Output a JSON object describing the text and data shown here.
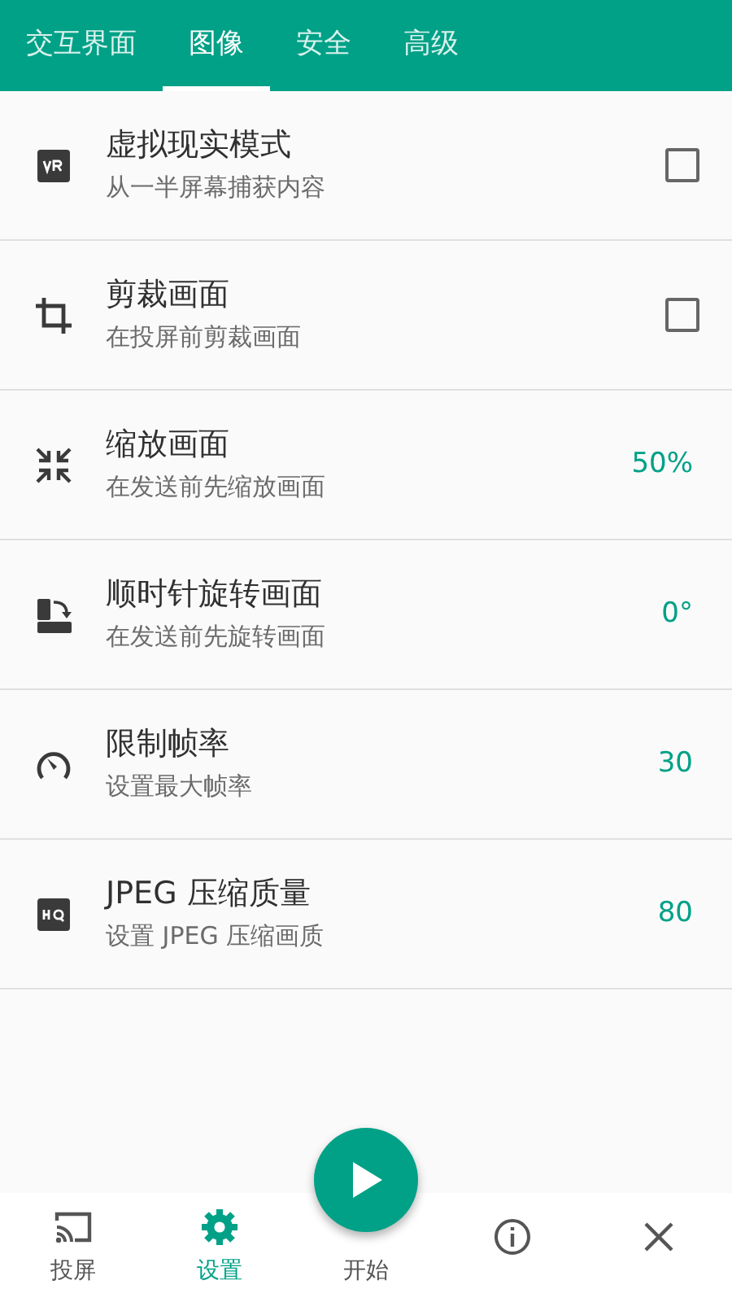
{
  "tabs": [
    {
      "label": "交互界面",
      "selected": false
    },
    {
      "label": "图像",
      "selected": true
    },
    {
      "label": "安全",
      "selected": false
    },
    {
      "label": "高级",
      "selected": false
    }
  ],
  "settings": [
    {
      "title": "虚拟现实模式",
      "subtitle": "从一半屏幕捕获内容",
      "kind": "checkbox",
      "checked": false
    },
    {
      "title": "剪裁画面",
      "subtitle": "在投屏前剪裁画面",
      "kind": "checkbox",
      "checked": false
    },
    {
      "title": "缩放画面",
      "subtitle": "在发送前先缩放画面",
      "kind": "value",
      "value": "50%"
    },
    {
      "title": "顺时针旋转画面",
      "subtitle": "在发送前先旋转画面",
      "kind": "value",
      "value": "0°"
    },
    {
      "title": "限制帧率",
      "subtitle": "设置最大帧率",
      "kind": "value",
      "value": "30"
    },
    {
      "title": "JPEG 压缩质量",
      "subtitle": "设置 JPEG 压缩画质",
      "kind": "value",
      "value": "80"
    }
  ],
  "bottom_nav": [
    {
      "label": "投屏",
      "selected": false
    },
    {
      "label": "设置",
      "selected": true
    },
    {
      "label": "开始",
      "selected": false
    },
    {
      "selected": false
    },
    {
      "selected": false
    }
  ]
}
